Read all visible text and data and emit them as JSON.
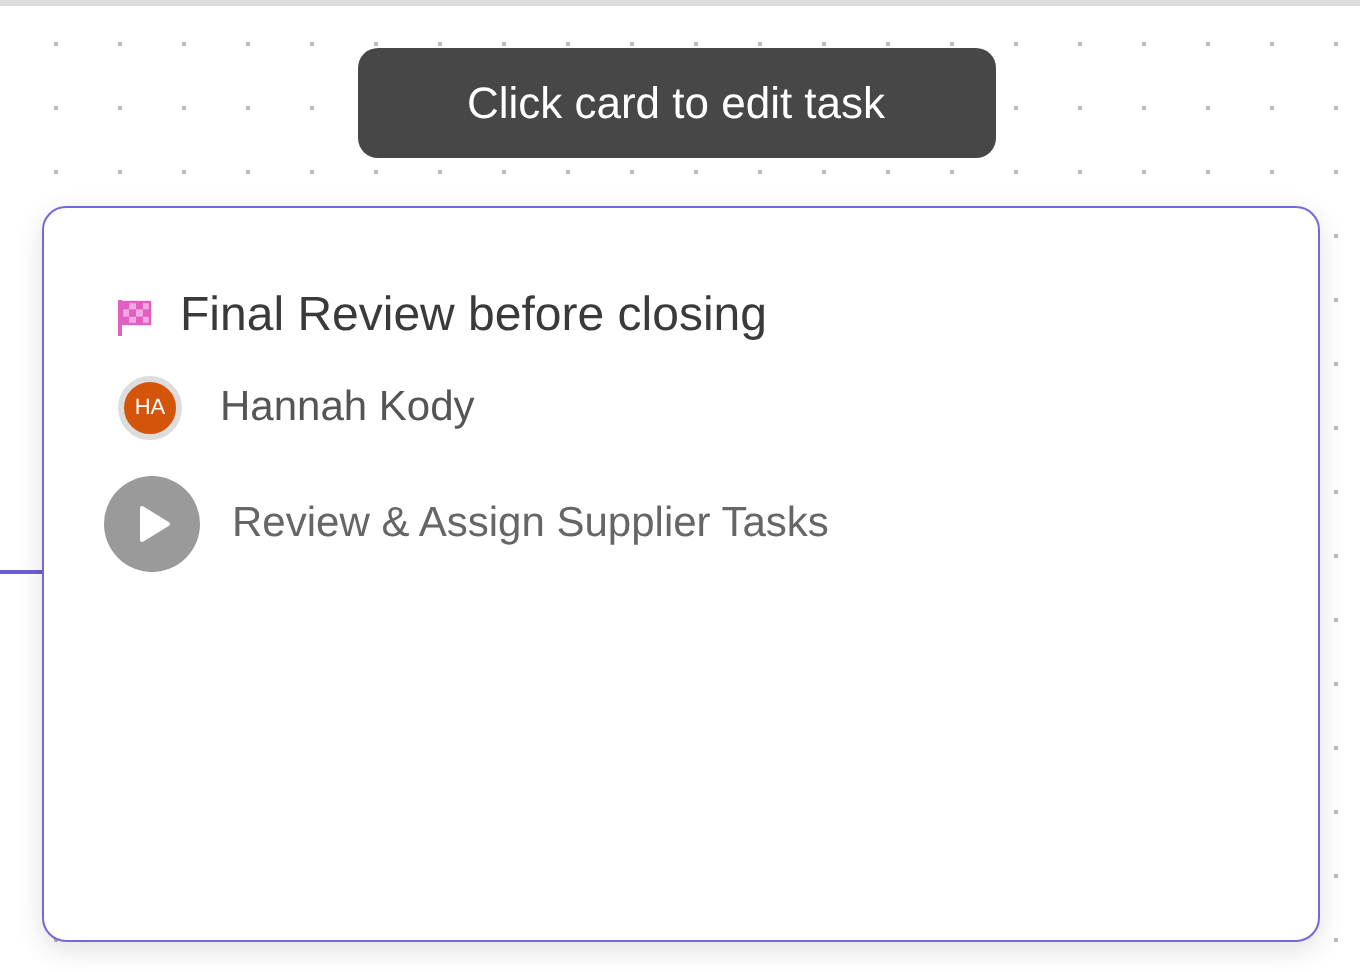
{
  "tooltip": {
    "text": "Click card to edit task"
  },
  "card": {
    "title": "Final Review before closing",
    "assignee": {
      "initials": "HA",
      "name": "Hannah Kody",
      "color": "#d4540a"
    },
    "step": {
      "text": "Review & Assign Supplier Tasks"
    }
  }
}
